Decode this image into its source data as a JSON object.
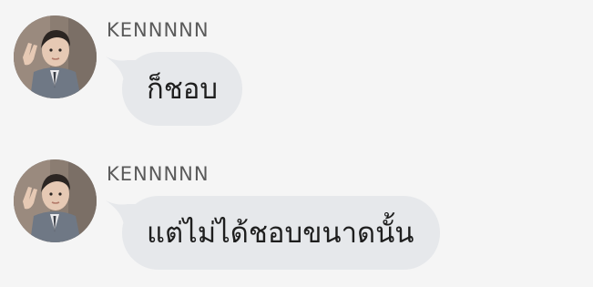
{
  "messages": [
    {
      "sender": "KENNNNN",
      "text": "ก็ชอบ",
      "avatar_icon": "avatar-photo"
    },
    {
      "sender": "KENNNNN",
      "text": "แต่ไม่ได้ชอบขนาดนั้น",
      "avatar_icon": "avatar-photo"
    }
  ],
  "colors": {
    "background": "#f5f5f5",
    "bubble": "#e6e8eb",
    "sender_text": "#5a5a5a",
    "message_text": "#1e1e1e"
  }
}
